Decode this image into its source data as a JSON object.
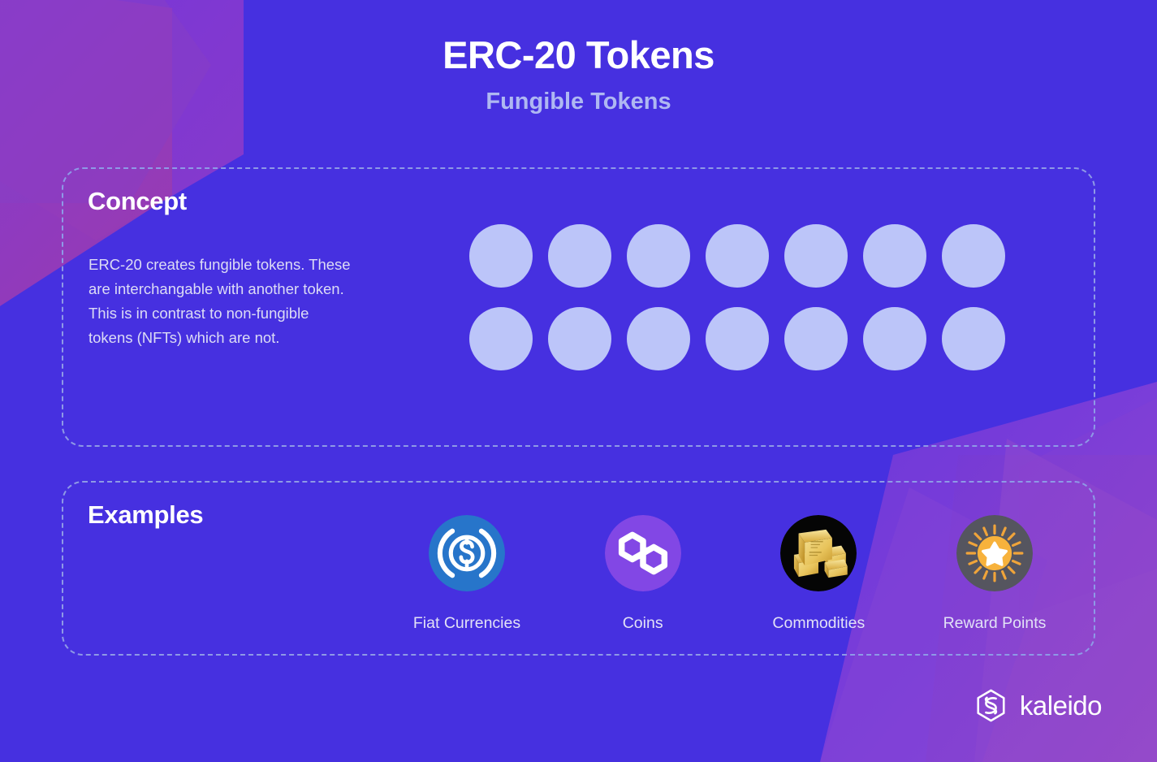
{
  "header": {
    "title": "ERC-20 Tokens",
    "subtitle": "Fungible Tokens"
  },
  "concept": {
    "heading": "Concept",
    "body": "ERC-20 creates fungible tokens. These are interchangable with another token. This is in contrast to non-fungible tokens (NFTs) which are not.",
    "token_count": 14,
    "token_rows": 2,
    "token_columns": 7,
    "token_color": "#BCC5F9"
  },
  "examples": {
    "heading": "Examples",
    "items": [
      {
        "label": "Fiat Currencies",
        "icon": "usdc-dollar-coin-icon",
        "icon_bg": "#2775CA"
      },
      {
        "label": "Coins",
        "icon": "polygon-hexagon-icon",
        "icon_bg": "#8247E5"
      },
      {
        "label": "Commodities",
        "icon": "gold-bars-icon",
        "icon_bg": "#050505"
      },
      {
        "label": "Reward Points",
        "icon": "star-burst-icon",
        "icon_bg": "#55555F"
      }
    ]
  },
  "brand": {
    "name": "kaleido",
    "mark": "kaleido-hexagon-logo-icon"
  },
  "theme": {
    "background": "#4630E0",
    "accent_light": "#BCC5F9",
    "dashed_border": "#8E99E6",
    "title_color": "#FFFFFF",
    "subtitle_color": "#AFB8F2",
    "body_color": "#DCDCF5",
    "label_color": "#E2E1F6"
  }
}
